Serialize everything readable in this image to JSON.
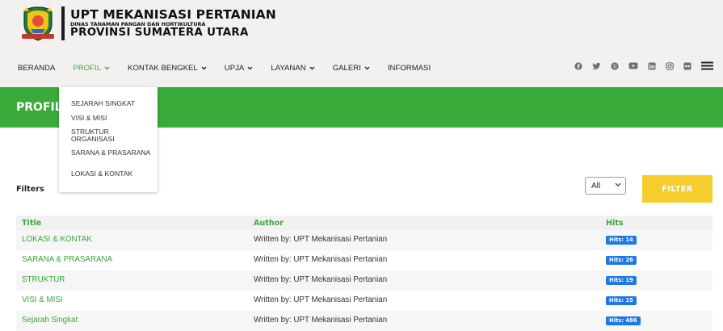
{
  "brand": {
    "title": "UPT MEKANISASI PERTANIAN",
    "subtitle": "DINAS TANAMAN PANGAN DAN HORTIKULTURA",
    "province": "PROVINSI SUMATERA UTARA"
  },
  "nav": {
    "items": [
      {
        "label": "BERANDA",
        "dropdown": false
      },
      {
        "label": "PROFIL",
        "dropdown": true,
        "active": true
      },
      {
        "label": "KONTAK BENGKEL",
        "dropdown": true
      },
      {
        "label": "UPJA",
        "dropdown": true
      },
      {
        "label": "LAYANAN",
        "dropdown": true
      },
      {
        "label": "GALERI",
        "dropdown": true
      },
      {
        "label": "INFORMASI",
        "dropdown": false
      }
    ],
    "social_icons": [
      "facebook-icon",
      "twitter-icon",
      "pinterest-icon",
      "youtube-icon",
      "linkedin-icon",
      "instagram-icon",
      "flickr-icon"
    ]
  },
  "dropdown": {
    "items": [
      {
        "label": "SEJARAH SINGKAT"
      },
      {
        "label": "VISI & MISI"
      },
      {
        "label": "STRUKTUR ORGANISASI"
      },
      {
        "label": "SARANA & PRASARANA"
      },
      {
        "label": "LOKASI & KONTAK"
      }
    ]
  },
  "banner": {
    "title": "PROFIL"
  },
  "filters": {
    "label": "Filters",
    "select_value": "All",
    "button_label": "FILTER"
  },
  "table": {
    "headers": {
      "title": "Title",
      "author": "Author",
      "hits": "Hits"
    },
    "rows": [
      {
        "title": "LOKASI & KONTAK",
        "author": "Written by: UPT Mekanisasi Pertanian",
        "hits": "Hits: 14"
      },
      {
        "title": "SARANA & PRASARANA",
        "author": "Written by: UPT Mekanisasi Pertanian",
        "hits": "Hits: 26"
      },
      {
        "title": "STRUKTUR",
        "author": "Written by: UPT Mekanisasi Pertanian",
        "hits": "Hits: 19"
      },
      {
        "title": "VISI & MISI",
        "author": "Written by: UPT Mekanisasi Pertanian",
        "hits": "Hits: 15"
      },
      {
        "title": "Sejarah Singkat",
        "author": "Written by: UPT Mekanisasi Pertanian",
        "hits": "Hits: 486"
      }
    ]
  },
  "colors": {
    "accent_green": "#3aaa3a",
    "filter_yellow": "#f5cd2c",
    "badge_blue": "#1e78e6",
    "header_bg": "#f2f1f0"
  }
}
